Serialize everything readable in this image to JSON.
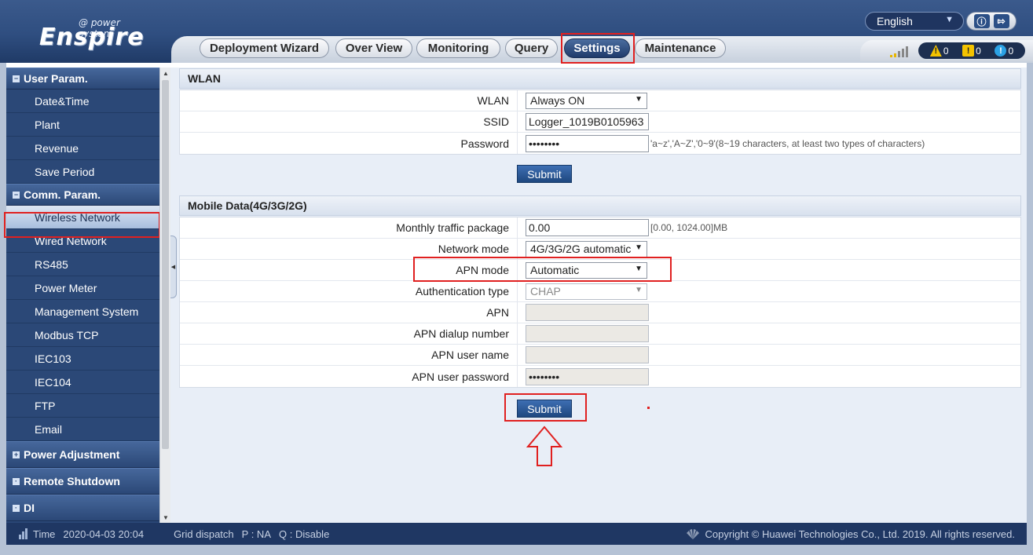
{
  "logo": {
    "sub": "@ power system",
    "main": "Enspire"
  },
  "language": {
    "selected": "English"
  },
  "nav": {
    "tabs": [
      "Deployment Wizard",
      "Over View",
      "Monitoring",
      "Query",
      "Settings",
      "Maintenance"
    ],
    "active": "Settings"
  },
  "alarms": {
    "major": "0",
    "minor": "0",
    "warning": "0"
  },
  "sidebar": {
    "groups": [
      {
        "label": "User Param.",
        "expanded": true,
        "items": [
          "Date&Time",
          "Plant",
          "Revenue",
          "Save Period"
        ]
      },
      {
        "label": "Comm. Param.",
        "expanded": true,
        "items": [
          "Wireless Network",
          "Wired Network",
          "RS485",
          "Power Meter",
          "Management System",
          "Modbus TCP",
          "IEC103",
          "IEC104",
          "FTP",
          "Email"
        ]
      },
      {
        "label": "Power Adjustment",
        "expanded": false
      },
      {
        "label": "Remote Shutdown",
        "expanded": false
      },
      {
        "label": "DI",
        "expanded": false
      }
    ],
    "active_item": "Wireless Network"
  },
  "wlan": {
    "title": "WLAN",
    "wlan_label": "WLAN",
    "wlan_value": "Always ON",
    "ssid_label": "SSID",
    "ssid_value": "Logger_1019B0105963",
    "password_label": "Password",
    "password_value": "••••••••",
    "password_hint": "'a~z','A~Z','0~9'(8~19 characters, at least two types of characters)",
    "submit_label": "Submit"
  },
  "mobile": {
    "title": "Mobile Data(4G/3G/2G)",
    "traffic_label": "Monthly traffic package",
    "traffic_value": "0.00",
    "traffic_hint": "[0.00, 1024.00]MB",
    "network_label": "Network mode",
    "network_value": "4G/3G/2G automatic",
    "apn_mode_label": "APN mode",
    "apn_mode_value": "Automatic",
    "auth_label": "Authentication type",
    "auth_value": "CHAP",
    "apn_label": "APN",
    "apn_value": "",
    "dialup_label": "APN dialup number",
    "dialup_value": "",
    "user_label": "APN user name",
    "user_value": "",
    "pass_label": "APN user password",
    "pass_value": "••••••••",
    "submit_label": "Submit"
  },
  "footer": {
    "time_label": "Time",
    "time_value": "2020-04-03 20:04",
    "grid_dispatch": "Grid dispatch",
    "p_value": "P : NA",
    "q_value": "Q : Disable",
    "copyright": "Copyright © Huawei Technologies Co., Ltd. 2019. All rights reserved."
  },
  "colors": {
    "header": "#2f4e80",
    "sidebar": "#2b4877",
    "highlight": "#e02020",
    "submit": "#1e477f"
  }
}
